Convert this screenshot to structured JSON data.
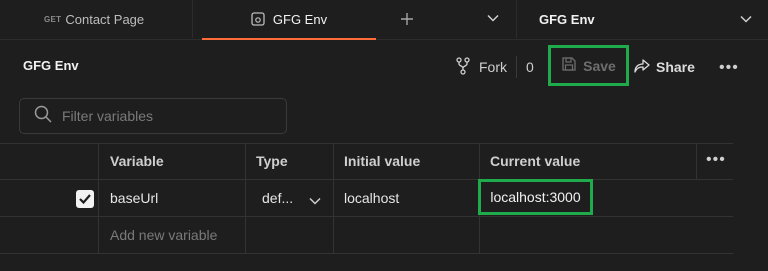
{
  "tabs": [
    {
      "method": "GET",
      "label": "Contact Page"
    },
    {
      "label": "GFG Env",
      "active": true
    }
  ],
  "env_selector": {
    "label": "GFG Env"
  },
  "header": {
    "title": "GFG Env",
    "fork_label": "Fork",
    "fork_count": "0",
    "save_label": "Save",
    "share_label": "Share"
  },
  "filter": {
    "placeholder": "Filter variables",
    "value": ""
  },
  "table": {
    "columns": [
      "Variable",
      "Type",
      "Initial value",
      "Current value"
    ],
    "rows": [
      {
        "enabled": true,
        "variable": "baseUrl",
        "type": "def...",
        "initial_value": "localhost",
        "current_value": "localhost:3000"
      }
    ],
    "add_placeholder": "Add new variable"
  },
  "colors": {
    "accent": "#ff6c37",
    "highlight": "#1faa4b",
    "background": "#1e1e1e"
  },
  "icons": [
    "environment-icon",
    "plus-icon",
    "chevron-down-icon",
    "fork-icon",
    "save-icon",
    "share-icon",
    "more-icon",
    "search-icon",
    "checkbox-checked-icon"
  ]
}
